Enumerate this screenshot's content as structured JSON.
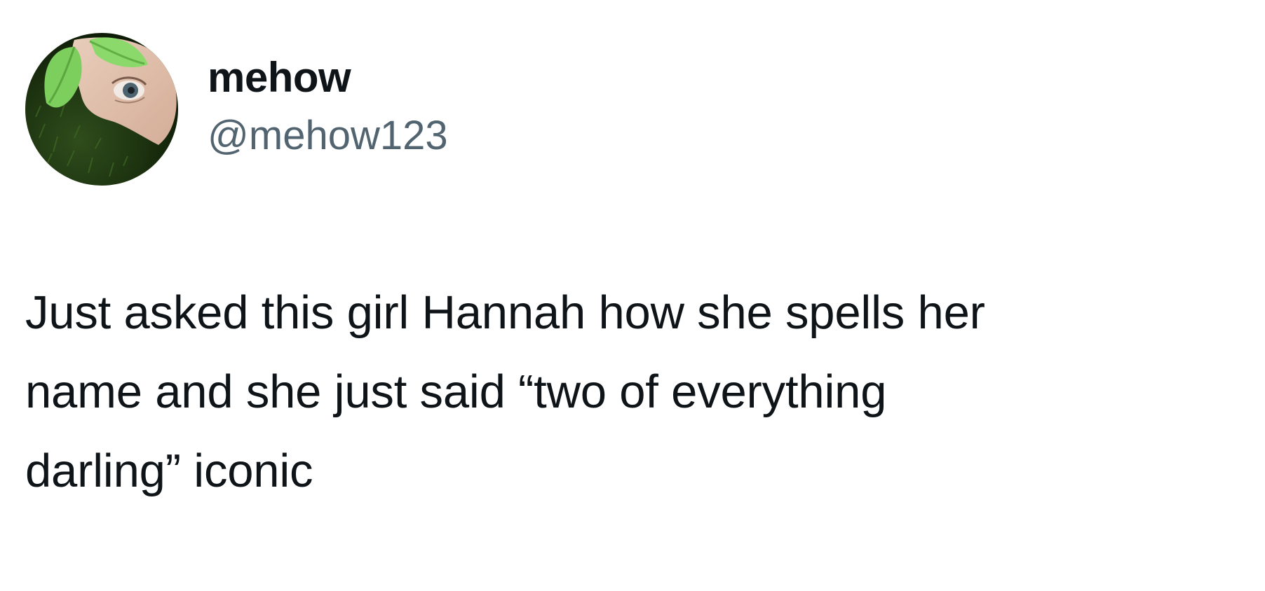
{
  "author": {
    "display_name": "mehow",
    "handle": "@mehow123",
    "avatar_icon": "profile-avatar-photo"
  },
  "tweet": {
    "text": "Just asked this girl Hannah how she spells her\nname and she just said “two of everything\ndarling” iconic"
  },
  "colors": {
    "background": "#ffffff",
    "primary_text": "#0f1419",
    "secondary_text": "#536471"
  }
}
